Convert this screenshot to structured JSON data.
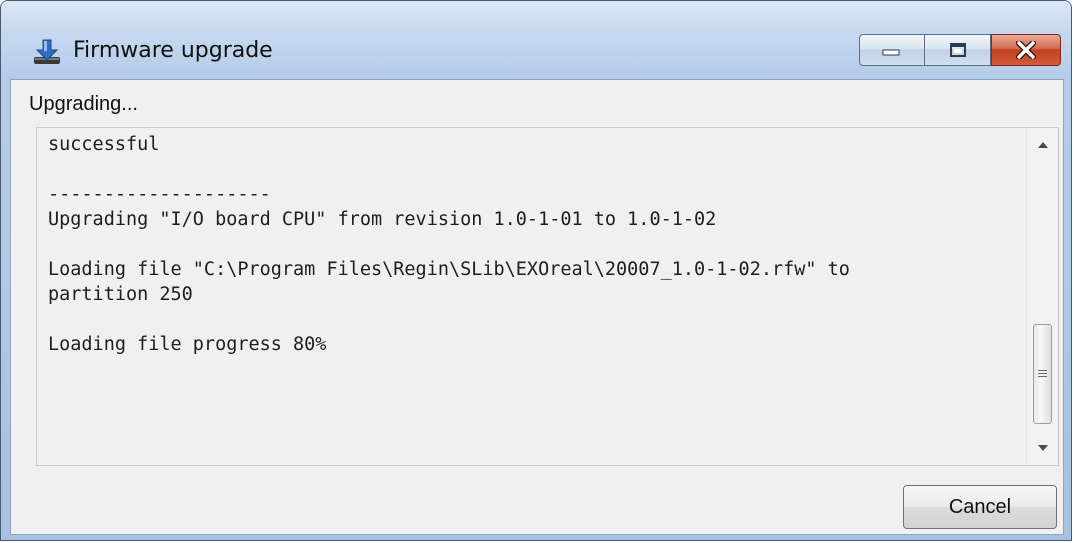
{
  "window": {
    "title": "Firmware upgrade",
    "icon": "download-arrow-icon",
    "accent_close": "#c2401f"
  },
  "status": {
    "label": "Upgrading..."
  },
  "log": {
    "lines": [
      "successful",
      "",
      "--------------------",
      "Upgrading \"I/O board CPU\" from revision 1.0-1-01 to 1.0-1-02",
      "",
      "Loading file \"C:\\Program Files\\Regin\\SLib\\EXOreal\\20007_1.0-1-02.rfw\" to",
      "partition 250",
      "",
      "Loading file progress 80%"
    ]
  },
  "buttons": {
    "cancel_label": "Cancel"
  }
}
